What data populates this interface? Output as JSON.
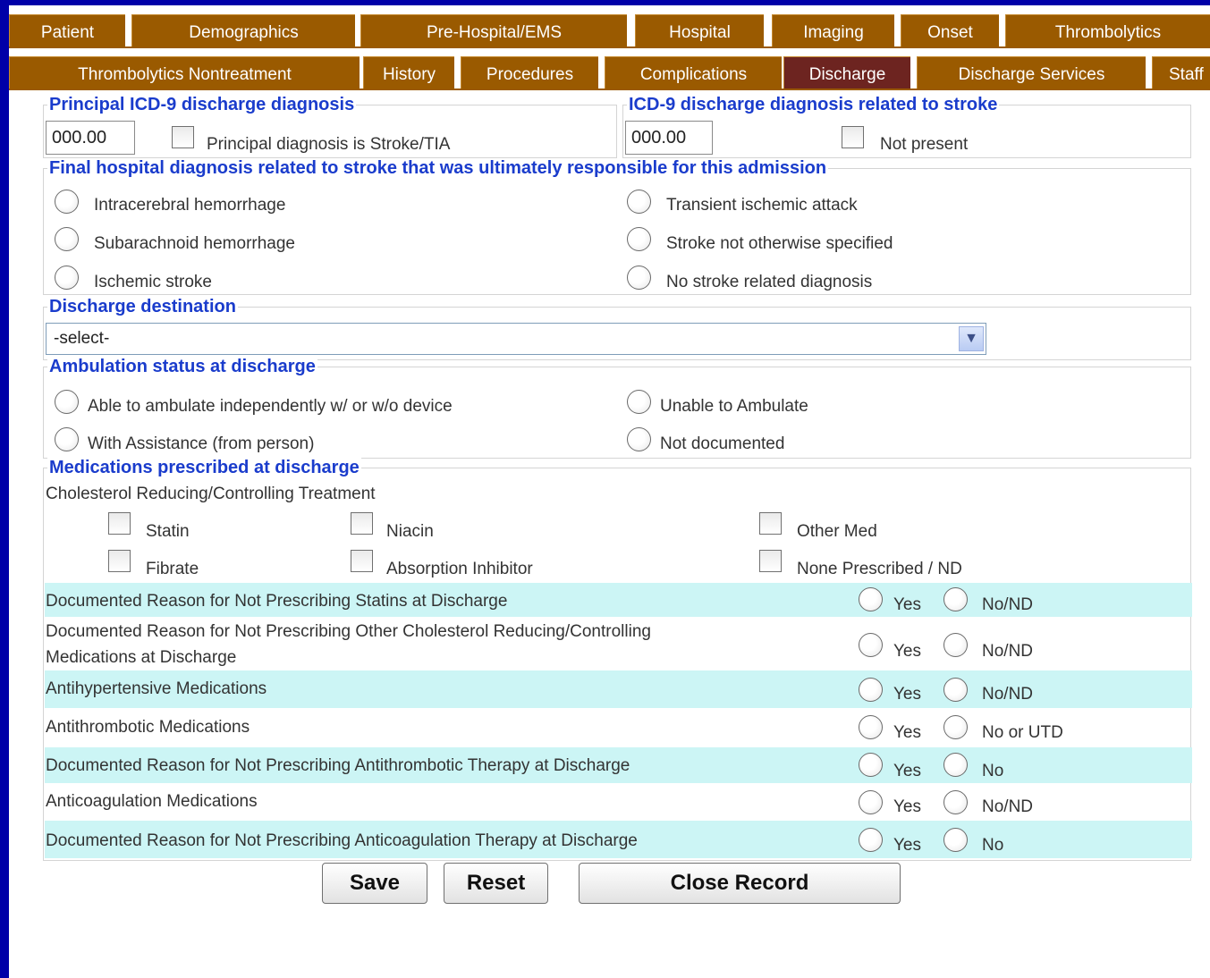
{
  "tabs_row1": [
    "Patient",
    "Demographics",
    "Pre-Hospital/EMS",
    "Hospital",
    "Imaging",
    "Onset",
    "Thrombolytics"
  ],
  "tabs_row2": [
    "Thrombolytics Nontreatment",
    "History",
    "Procedures",
    "Complications",
    "Discharge",
    "Discharge Services",
    "Staff"
  ],
  "active_tab": "Discharge",
  "principal": {
    "legend": "Principal ICD-9 discharge diagnosis",
    "value": "000.00",
    "checkbox_label": "Principal diagnosis is Stroke/TIA"
  },
  "related": {
    "legend": "ICD-9 discharge diagnosis related to stroke",
    "value": "000.00",
    "checkbox_label": "Not present"
  },
  "final_dx": {
    "legend": "Final hospital diagnosis related to stroke that was ultimately responsible for this admission",
    "options": [
      "Intracerebral hemorrhage",
      "Subarachnoid hemorrhage",
      "Ischemic stroke",
      "Transient ischemic attack",
      "Stroke not otherwise specified",
      "No stroke related diagnosis"
    ]
  },
  "destination": {
    "legend": "Discharge destination",
    "selected": "-select-"
  },
  "ambulation": {
    "legend": "Ambulation status at discharge",
    "options": [
      "Able to ambulate independently w/ or w/o device",
      "With Assistance (from person)",
      "Unable to Ambulate",
      "Not documented"
    ]
  },
  "medications": {
    "legend": "Medications prescribed at discharge",
    "cholesterol_title": "Cholesterol Reducing/Controlling Treatment",
    "cholesterol_options": [
      "Statin",
      "Fibrate",
      "Niacin",
      "Absorption Inhibitor",
      "Other Med",
      "None Prescribed / ND"
    ],
    "rows": [
      {
        "label": "Documented Reason for Not Prescribing Statins at Discharge",
        "yes": "Yes",
        "no": "No/ND"
      },
      {
        "label": "Documented Reason for Not Prescribing Other Cholesterol Reducing/Controlling",
        "label2": "Medications at Discharge",
        "yes": "Yes",
        "no": "No/ND"
      },
      {
        "label": "Antihypertensive Medications",
        "yes": "Yes",
        "no": "No/ND"
      },
      {
        "label": "Antithrombotic Medications",
        "yes": "Yes",
        "no": "No or UTD"
      },
      {
        "label": "Documented Reason for Not Prescribing Antithrombotic Therapy at Discharge",
        "yes": "Yes",
        "no": "No"
      },
      {
        "label": "Anticoagulation Medications",
        "yes": "Yes",
        "no": "No/ND"
      },
      {
        "label": "Documented Reason for Not Prescribing Anticoagulation Therapy at Discharge",
        "yes": "Yes",
        "no": "No"
      }
    ]
  },
  "buttons": {
    "save": "Save",
    "reset": "Reset",
    "close": "Close Record"
  }
}
